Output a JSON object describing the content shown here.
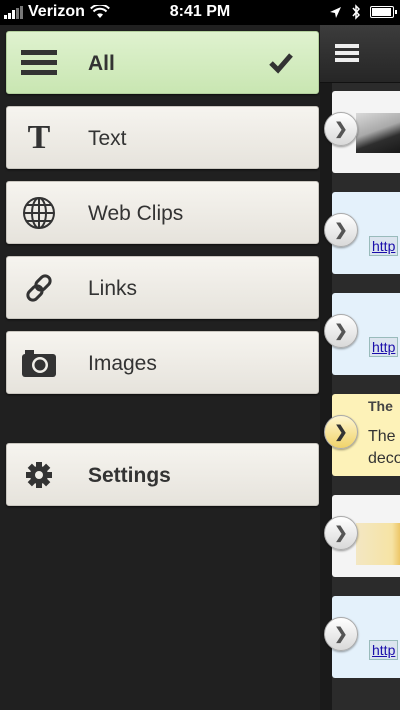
{
  "status_bar": {
    "carrier": "Verizon",
    "time": "8:41 PM"
  },
  "menu": {
    "items": [
      {
        "label": "All",
        "icon": "hamburger-icon",
        "selected": true
      },
      {
        "label": "Text",
        "icon": "text-t-icon",
        "selected": false
      },
      {
        "label": "Web Clips",
        "icon": "globe-icon",
        "selected": false
      },
      {
        "label": "Links",
        "icon": "chain-link-icon",
        "selected": false
      },
      {
        "label": "Images",
        "icon": "camera-icon",
        "selected": false
      }
    ],
    "settings": {
      "label": "Settings",
      "icon": "gear-icon"
    }
  },
  "content": {
    "cards": [
      {
        "kind": "image",
        "style": "white"
      },
      {
        "kind": "link",
        "style": "blue",
        "text": "http"
      },
      {
        "kind": "link",
        "style": "blue",
        "text": "http"
      },
      {
        "kind": "note",
        "style": "yellow",
        "title": "The",
        "line1": "The",
        "line2": "deco"
      },
      {
        "kind": "image",
        "style": "white"
      },
      {
        "kind": "link",
        "style": "blue",
        "text": "http"
      }
    ]
  },
  "colors": {
    "selected_item_bg": "#d6edc4",
    "menu_bg": "#202020",
    "item_bg": "#f0eee8"
  }
}
